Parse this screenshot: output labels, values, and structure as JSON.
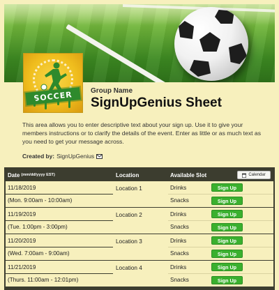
{
  "header": {
    "group_label": "Group Name",
    "title": "SignUpGenius Sheet",
    "description": "This area allows you to enter descriptive text about your sign up. Use it to give your members instructions or to clarify the details of the event. Enter as little or as much text as you need to get your message across.",
    "created_by_label": "Created by:",
    "created_by_name": "SignUpGenius"
  },
  "logo": {
    "text": "SOCCER"
  },
  "table": {
    "headers": {
      "date": "Date",
      "date_format": "(mm/dd/yyyy EST)",
      "location": "Location",
      "slot": "Available Slot",
      "calendar_button": "Calendar"
    },
    "signup_label": "Sign Up",
    "groups": [
      {
        "date": "11/18/2019",
        "time": "(Mon. 9:00am - 10:00am)",
        "location": "Location 1",
        "slots": [
          "Drinks",
          "Snacks"
        ]
      },
      {
        "date": "11/19/2019",
        "time": "(Tue. 1:00pm - 3:00pm)",
        "location": "Location 2",
        "slots": [
          "Drinks",
          "Snacks"
        ]
      },
      {
        "date": "11/20/2019",
        "time": "(Wed. 7:00am - 9:00am)",
        "location": "Location 3",
        "slots": [
          "Drinks",
          "Snacks"
        ]
      },
      {
        "date": "11/21/2019",
        "time": "(Thurs. 11:00am - 12:01pm)",
        "location": "Location 4",
        "slots": [
          "Drinks",
          "Snacks"
        ]
      }
    ]
  },
  "colors": {
    "page_background": "#f7f0bd",
    "table_header": "#3c3d2f",
    "signup_button": "#3ab02e"
  },
  "icons": [
    "soccer-ball-icon",
    "soccer-logo-icon",
    "mail-icon",
    "calendar-icon"
  ]
}
